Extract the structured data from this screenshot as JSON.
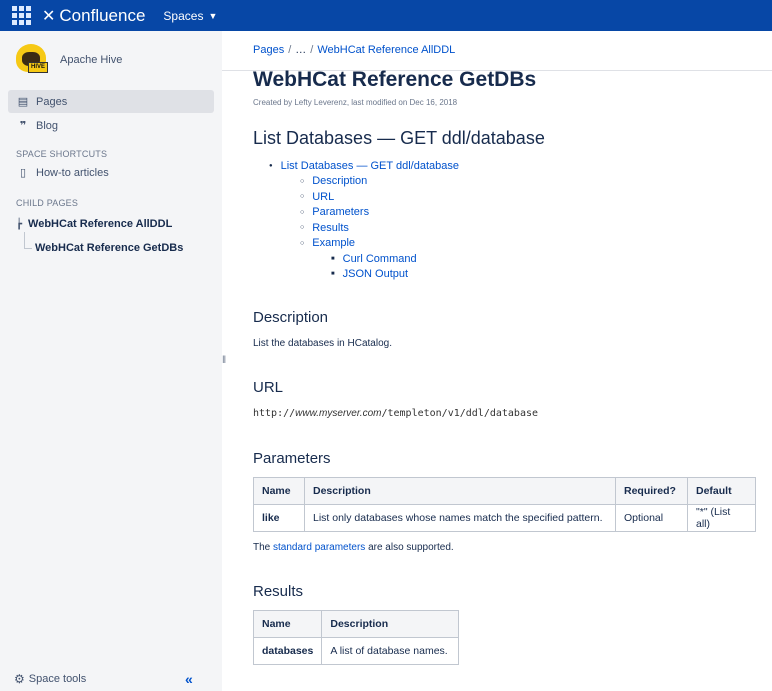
{
  "topbar": {
    "app_name": "Confluence",
    "spaces_label": "Spaces"
  },
  "sidebar": {
    "space_name": "Apache Hive",
    "logo_text": "HIVE",
    "nav": [
      {
        "label": "Pages",
        "icon": "pages-icon",
        "active": true
      },
      {
        "label": "Blog",
        "icon": "quote-icon",
        "active": false
      }
    ],
    "shortcuts_label": "SPACE SHORTCUTS",
    "shortcuts": [
      {
        "label": "How-to articles",
        "icon": "document-icon"
      }
    ],
    "child_pages_label": "CHILD PAGES",
    "child_parent": "WebHCat Reference AllDDL",
    "child_current": "WebHCat Reference GetDBs",
    "space_tools": "Space tools"
  },
  "breadcrumbs": {
    "items": [
      "Pages",
      "…",
      "WebHCat Reference AllDDL"
    ]
  },
  "page": {
    "title": "WebHCat Reference GetDBs",
    "byline": "Created by Lefty Leverenz, last modified on Dec 16, 2018",
    "heading": "List Databases — GET ddl/database",
    "toc": [
      {
        "label": "List Databases — GET ddl/database",
        "level": 1
      },
      {
        "label": "Description",
        "level": 2
      },
      {
        "label": "URL",
        "level": 2
      },
      {
        "label": "Parameters",
        "level": 2
      },
      {
        "label": "Results",
        "level": 2
      },
      {
        "label": "Example",
        "level": 2
      },
      {
        "label": "Curl Command",
        "level": 3
      },
      {
        "label": "JSON Output",
        "level": 3
      }
    ],
    "description_heading": "Description",
    "description_text": "List the databases in HCatalog.",
    "url_heading": "URL",
    "url_prefix": "http://",
    "url_host": "www.myserver.com",
    "url_path": "/templeton/v1/ddl/database",
    "parameters_heading": "Parameters",
    "parameters_table": {
      "headers": [
        "Name",
        "Description",
        "Required?",
        "Default"
      ],
      "rows": [
        [
          "like",
          "List only databases whose names match the specified pattern.",
          "Optional",
          "\"*\" (List all)"
        ]
      ]
    },
    "params_note_pre": "The ",
    "params_note_link": "standard parameters",
    "params_note_post": " are also supported.",
    "results_heading": "Results",
    "results_table": {
      "headers": [
        "Name",
        "Description"
      ],
      "rows": [
        [
          "databases",
          "A list of database names."
        ]
      ]
    }
  }
}
